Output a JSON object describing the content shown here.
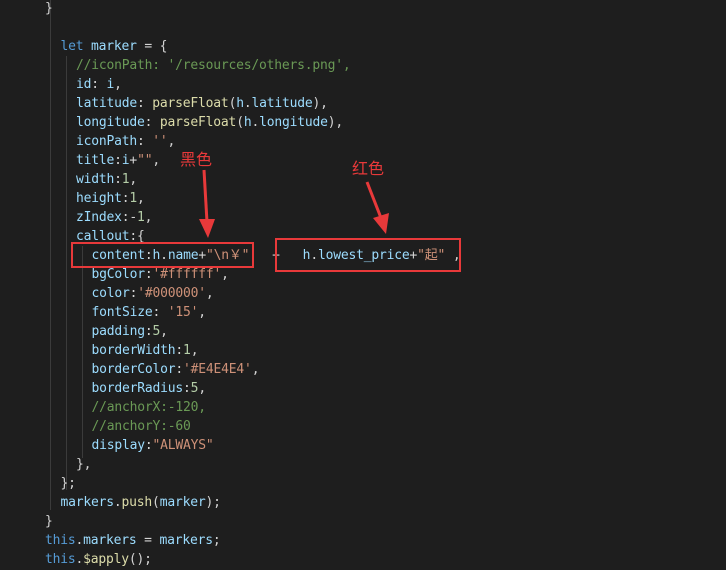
{
  "code_lines": [
    {
      "i": 0,
      "t": [
        [
          "pun",
          "}"
        ]
      ]
    },
    {
      "i": 1,
      "t": []
    },
    {
      "i": 1,
      "t": [
        [
          "kw",
          "let"
        ],
        [
          "pun",
          " "
        ],
        [
          "var",
          "marker"
        ],
        [
          "pun",
          " = {"
        ]
      ]
    },
    {
      "i": 2,
      "t": [
        [
          "cmt",
          "//iconPath: '/resources/others.png',"
        ]
      ]
    },
    {
      "i": 2,
      "t": [
        [
          "var",
          "id"
        ],
        [
          "pun",
          ": "
        ],
        [
          "var",
          "i"
        ],
        [
          "pun",
          ","
        ]
      ]
    },
    {
      "i": 2,
      "t": [
        [
          "var",
          "latitude"
        ],
        [
          "pun",
          ": "
        ],
        [
          "fn",
          "parseFloat"
        ],
        [
          "pun",
          "("
        ],
        [
          "var",
          "h"
        ],
        [
          "pun",
          "."
        ],
        [
          "var",
          "latitude"
        ],
        [
          "pun",
          "),"
        ]
      ]
    },
    {
      "i": 2,
      "t": [
        [
          "var",
          "longitude"
        ],
        [
          "pun",
          ": "
        ],
        [
          "fn",
          "parseFloat"
        ],
        [
          "pun",
          "("
        ],
        [
          "var",
          "h"
        ],
        [
          "pun",
          "."
        ],
        [
          "var",
          "longitude"
        ],
        [
          "pun",
          "),"
        ]
      ]
    },
    {
      "i": 2,
      "t": [
        [
          "var",
          "iconPath"
        ],
        [
          "pun",
          ": "
        ],
        [
          "str",
          "''"
        ],
        [
          "pun",
          ","
        ]
      ]
    },
    {
      "i": 2,
      "t": [
        [
          "var",
          "title"
        ],
        [
          "pun",
          ":"
        ],
        [
          "var",
          "i"
        ],
        [
          "pun",
          "+"
        ],
        [
          "str",
          "\"\""
        ],
        [
          "pun",
          ","
        ]
      ]
    },
    {
      "i": 2,
      "t": [
        [
          "var",
          "width"
        ],
        [
          "pun",
          ":"
        ],
        [
          "num",
          "1"
        ],
        [
          "pun",
          ","
        ]
      ]
    },
    {
      "i": 2,
      "t": [
        [
          "var",
          "height"
        ],
        [
          "pun",
          ":"
        ],
        [
          "num",
          "1"
        ],
        [
          "pun",
          ","
        ]
      ]
    },
    {
      "i": 2,
      "t": [
        [
          "var",
          "zIndex"
        ],
        [
          "pun",
          ":-"
        ],
        [
          "num",
          "1"
        ],
        [
          "pun",
          ","
        ]
      ]
    },
    {
      "i": 2,
      "t": [
        [
          "var",
          "callout"
        ],
        [
          "pun",
          ":{"
        ]
      ]
    },
    {
      "i": 3,
      "t": [
        [
          "var",
          "content"
        ],
        [
          "pun",
          ":"
        ],
        [
          "var",
          "h"
        ],
        [
          "pun",
          "."
        ],
        [
          "var",
          "name"
        ],
        [
          "pun",
          "+"
        ],
        [
          "str",
          "\"\\n￥\""
        ],
        [
          "pun",
          "   +   "
        ],
        [
          "var",
          "h"
        ],
        [
          "pun",
          "."
        ],
        [
          "var",
          "lowest_price"
        ],
        [
          "pun",
          "+"
        ],
        [
          "str",
          "\"起\""
        ],
        [
          "pun",
          " ,"
        ]
      ]
    },
    {
      "i": 3,
      "t": [
        [
          "var",
          "bgColor"
        ],
        [
          "pun",
          ":"
        ],
        [
          "str",
          "'#ffffff'"
        ],
        [
          "pun",
          ","
        ]
      ]
    },
    {
      "i": 3,
      "t": [
        [
          "var",
          "color"
        ],
        [
          "pun",
          ":"
        ],
        [
          "str",
          "'#000000'"
        ],
        [
          "pun",
          ","
        ]
      ]
    },
    {
      "i": 3,
      "t": [
        [
          "var",
          "fontSize"
        ],
        [
          "pun",
          ": "
        ],
        [
          "str",
          "'15'"
        ],
        [
          "pun",
          ","
        ]
      ]
    },
    {
      "i": 3,
      "t": [
        [
          "var",
          "padding"
        ],
        [
          "pun",
          ":"
        ],
        [
          "num",
          "5"
        ],
        [
          "pun",
          ","
        ]
      ]
    },
    {
      "i": 3,
      "t": [
        [
          "var",
          "borderWidth"
        ],
        [
          "pun",
          ":"
        ],
        [
          "num",
          "1"
        ],
        [
          "pun",
          ","
        ]
      ]
    },
    {
      "i": 3,
      "t": [
        [
          "var",
          "borderColor"
        ],
        [
          "pun",
          ":"
        ],
        [
          "str",
          "'#E4E4E4'"
        ],
        [
          "pun",
          ","
        ]
      ]
    },
    {
      "i": 3,
      "t": [
        [
          "var",
          "borderRadius"
        ],
        [
          "pun",
          ":"
        ],
        [
          "num",
          "5"
        ],
        [
          "pun",
          ","
        ]
      ]
    },
    {
      "i": 3,
      "t": [
        [
          "cmt",
          "//anchorX:-120,"
        ]
      ]
    },
    {
      "i": 3,
      "t": [
        [
          "cmt",
          "//anchorY:-60"
        ]
      ]
    },
    {
      "i": 3,
      "t": [
        [
          "var",
          "display"
        ],
        [
          "pun",
          ":"
        ],
        [
          "str",
          "\"ALWAYS\""
        ]
      ]
    },
    {
      "i": 2,
      "t": [
        [
          "pun",
          "},"
        ]
      ]
    },
    {
      "i": 1,
      "t": [
        [
          "pun",
          "};"
        ]
      ]
    },
    {
      "i": 1,
      "t": [
        [
          "var",
          "markers"
        ],
        [
          "pun",
          "."
        ],
        [
          "fn",
          "push"
        ],
        [
          "pun",
          "("
        ],
        [
          "var",
          "marker"
        ],
        [
          "pun",
          ");"
        ]
      ]
    },
    {
      "i": 0,
      "t": [
        [
          "pun",
          "}"
        ]
      ]
    },
    {
      "i": 0,
      "t": [
        [
          "kw",
          "this"
        ],
        [
          "pun",
          "."
        ],
        [
          "var",
          "markers"
        ],
        [
          "pun",
          " = "
        ],
        [
          "var",
          "markers"
        ],
        [
          "pun",
          ";"
        ]
      ]
    },
    {
      "i": 0,
      "t": [
        [
          "kw",
          "this"
        ],
        [
          "pun",
          "."
        ],
        [
          "fn",
          "$apply"
        ],
        [
          "pun",
          "();"
        ]
      ]
    }
  ],
  "annotations": {
    "black_label": "黑色",
    "red_label": "红色"
  },
  "colors": {
    "background": "#1e1e1e",
    "annotation_red": "#e8393a"
  }
}
